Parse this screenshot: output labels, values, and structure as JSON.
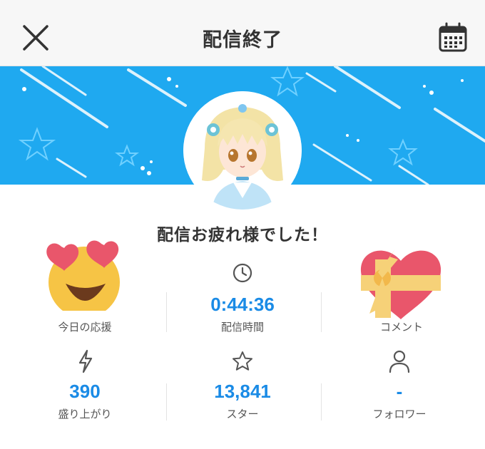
{
  "header": {
    "title": "配信終了",
    "close_icon": "close-icon",
    "calendar_icon": "calendar-icon"
  },
  "banner": {
    "color": "#1fa9f0",
    "avatar": "streamer-avatar"
  },
  "message": "配信お疲れ様でした！",
  "stats": {
    "cheer": {
      "icon": "heart-eyes-emoji-icon",
      "value": "",
      "label": "今日の応援"
    },
    "duration": {
      "icon": "clock-icon",
      "value": "0:44:36",
      "label": "配信時間"
    },
    "comments": {
      "icon": "gift-heart-icon",
      "value": "",
      "label": "コメント"
    },
    "excitement": {
      "icon": "lightning-icon",
      "value": "390",
      "label": "盛り上がり"
    },
    "stars": {
      "icon": "star-icon",
      "value": "13,841",
      "label": "スター"
    },
    "followers": {
      "icon": "person-icon",
      "value": "-",
      "label": "フォロワー"
    }
  },
  "colors": {
    "accent": "#1a8be6",
    "banner": "#1fa9f0",
    "heart": "#e9566b",
    "emoji": "#f6c445"
  }
}
